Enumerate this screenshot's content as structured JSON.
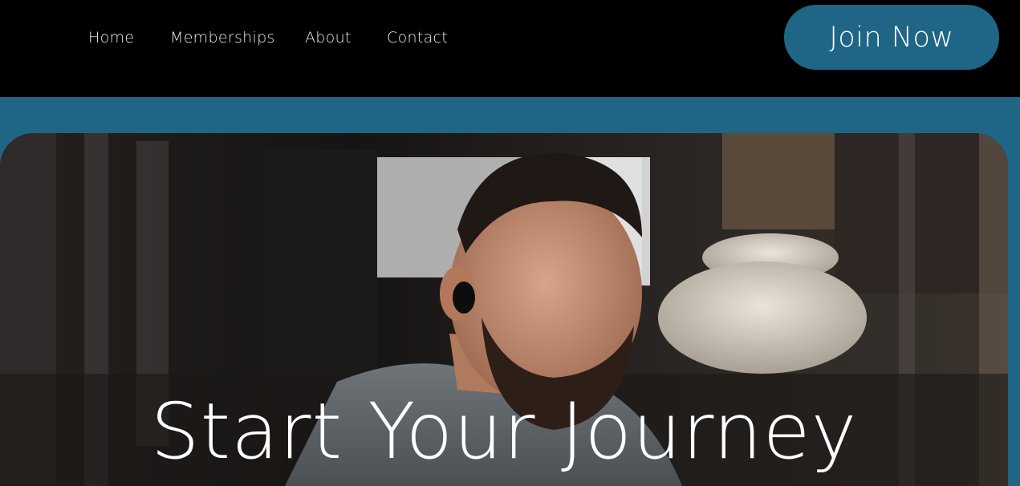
{
  "nav": {
    "links": [
      "Home",
      "Memberships",
      "About",
      "Contact"
    ],
    "cta": "Join Now"
  },
  "hero": {
    "title": "Start Your Journey",
    "image": "man-with-wireless-earbud-in-gym"
  },
  "colors": {
    "topbar": "#000000",
    "accent": "#1f6585",
    "text": "#ffffff"
  }
}
